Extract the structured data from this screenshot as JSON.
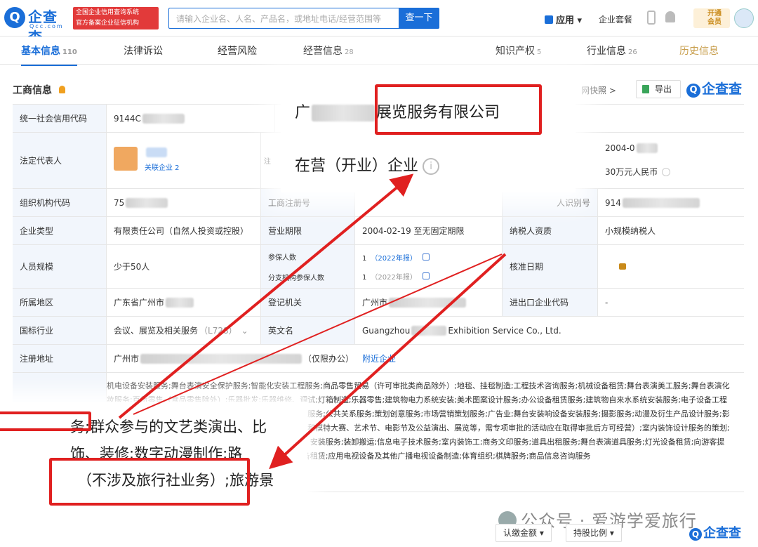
{
  "header": {
    "logo_text": "企查查",
    "logo_sub": "Qcc.com",
    "badge_line1": "全国企业信用查询系统",
    "badge_line2": "官方备案企业征信机构",
    "search_placeholder": "请输入企业名、人名、产品名，或地址电话/经营范围等",
    "search_button": "查一下",
    "apps_label": "应用",
    "plan_label": "企业套餐",
    "vip_line1": "开通",
    "vip_line2": "会员"
  },
  "tabs": [
    {
      "label": "基本信息",
      "count": "110"
    },
    {
      "label": "法律诉讼",
      "count": ""
    },
    {
      "label": "经营风险",
      "count": ""
    },
    {
      "label": "经营信息",
      "count": "28"
    },
    {
      "label": "知识产权",
      "count": "5"
    },
    {
      "label": "行业信息",
      "count": "26"
    },
    {
      "label": "历史信息",
      "count": ""
    }
  ],
  "section": {
    "title": "工商信息",
    "snapshot": "网快照 >",
    "export": "导出",
    "brand": "企查查"
  },
  "table": {
    "credit_code_label": "统一社会信用代码",
    "credit_code_prefix": "9144C",
    "legal_rep_label": "法定代表人",
    "related_companies": "关联企业 2",
    "legal_rep_tail": "注",
    "est_date_partial": "2004-0",
    "capital_partial": "30万元人民币",
    "org_code_label": "组织机构代码",
    "org_code_prefix": "75",
    "reg_no_label": "工商注册号",
    "taxpayer_id_label": "人识别号",
    "taxpayer_id_prefix": "914",
    "type_label": "企业类型",
    "type_value": "有限责任公司（自然人投资或控股）",
    "term_label": "营业期限",
    "term_value": "2004-02-19 至无固定期限",
    "taxpayer_label": "纳税人资质",
    "taxpayer_value": "小规模纳税人",
    "staff_label": "人员规模",
    "staff_value": "少于50人",
    "insured_label": "参保人数",
    "insured_value": "1",
    "insured_report": "（2022年报）",
    "branch_insured_label": "分支机构参保人数",
    "branch_insured_value": "1",
    "branch_insured_report": "（2022年报）",
    "approval_label": "核准日期",
    "region_label": "所属地区",
    "region_value": "广东省广州市",
    "authority_label": "登记机关",
    "authority_value": "广州市",
    "import_export_label": "进出口企业代码",
    "import_export_value": "-",
    "industry_label": "国标行业",
    "industry_value": "会议、展览及相关服务",
    "industry_code": "（L728）",
    "english_label": "英文名",
    "english_prefix": "Guangzhou",
    "english_suffix": "Exhibition Service Co., Ltd.",
    "address_label": "注册地址",
    "address_value": "广州市",
    "address_note": "（仅限办公）",
    "nearby": "附近企业",
    "scope_text": "机电设备安装服务;舞台表演安全保护服务;智能化安装工程服务;商品零售贸易（许可审批类商品除外）;地毯、挂毯制造;工程技术咨询服务;机械设备租赁;舞台表演美工服务;舞台表演化妆服务;百货零售（食品零售除外）;乐器批发;乐器维修、调试;灯箱制造;乐器零售;建筑物电力系统安装;美术图案设计服务;办公设备租赁服务;建筑物自来水系统安装服务;电子设备工程安装服务;会议及展览服务;企业形象策划服务;文化艺术咨询服务;公共关系服务;策划创意服务;市场营销策划服务;广告业;舞台安装响设备安装服务;摄影服务;动漫及衍生产品设计服务;影视经纪代理服务;展台设计服务;公司礼仪服务;大型活动组织和模特大赛、艺术节、电影节及公益演出、展览等，需专项审批的活动应在取得审批后方可经营）;室内装饰设计服务的策划;商品批发贸易（许可审批类商品除外）;标识、标志牌设计、安装服务;装卸搬运;信息电子技术服务;室内装饰工;商务文印服务;道具出租服务;舞台表演道具服务;灯光设备租赁;向游客提供旅游、交通、住宿、餐饮等代理服务管理;音频和视频设备租赁;应用电视设备及其他广播电视设备制造;体育组织;棋牌服务;商品信息咨询服务"
  },
  "zoom_top": {
    "company_prefix": "广",
    "company_suffix": "展览服务有限公司",
    "status": "在营（开业）企业"
  },
  "zoom_bottom": {
    "line1": "务;群众参与的文艺类演出、比",
    "line2": "饰、装修;数字动漫制作;路",
    "line3": "（不涉及旅行社业务）;旅游景"
  },
  "footer": {
    "watermark": "公众号 · 爱游学爱旅行",
    "btn1": "认缴金额",
    "btn2": "持股比例",
    "brand": "企查查"
  },
  "colors": {
    "primary": "#1a6ed8",
    "highlight": "#e02020",
    "label_bg": "#f2f6fc"
  }
}
